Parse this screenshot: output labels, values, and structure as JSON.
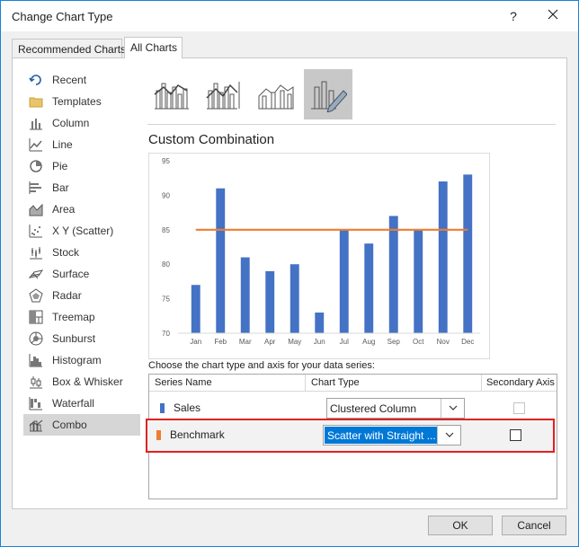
{
  "window": {
    "title": "Change Chart Type",
    "help": "?",
    "close": "✕"
  },
  "tabs": [
    {
      "label": "Recommended Charts"
    },
    {
      "label": "All Charts"
    }
  ],
  "sidebar": {
    "items": [
      {
        "label": "Recent",
        "icon": "recent-icon"
      },
      {
        "label": "Templates",
        "icon": "templates-folder-icon"
      },
      {
        "label": "Column",
        "icon": "column-chart-icon"
      },
      {
        "label": "Line",
        "icon": "line-chart-icon"
      },
      {
        "label": "Pie",
        "icon": "pie-chart-icon"
      },
      {
        "label": "Bar",
        "icon": "bar-chart-icon"
      },
      {
        "label": "Area",
        "icon": "area-chart-icon"
      },
      {
        "label": "X Y (Scatter)",
        "icon": "scatter-chart-icon"
      },
      {
        "label": "Stock",
        "icon": "stock-chart-icon"
      },
      {
        "label": "Surface",
        "icon": "surface-chart-icon"
      },
      {
        "label": "Radar",
        "icon": "radar-chart-icon"
      },
      {
        "label": "Treemap",
        "icon": "treemap-chart-icon"
      },
      {
        "label": "Sunburst",
        "icon": "sunburst-chart-icon"
      },
      {
        "label": "Histogram",
        "icon": "histogram-chart-icon"
      },
      {
        "label": "Box & Whisker",
        "icon": "box-whisker-chart-icon"
      },
      {
        "label": "Waterfall",
        "icon": "waterfall-chart-icon"
      },
      {
        "label": "Combo",
        "icon": "combo-chart-icon"
      }
    ],
    "selected": "Combo"
  },
  "subtypes": {
    "icons": [
      "clustered-column-line-icon",
      "clustered-column-line-secondary-icon",
      "stacked-area-column-icon",
      "custom-combination-icon"
    ],
    "selected": "custom-combination-icon"
  },
  "section_title": "Custom Combination",
  "chart_data": {
    "type": "bar",
    "categories": [
      "Jan",
      "Feb",
      "Mar",
      "Apr",
      "May",
      "Jun",
      "Jul",
      "Aug",
      "Sep",
      "Oct",
      "Nov",
      "Dec"
    ],
    "series": [
      {
        "name": "Sales",
        "type": "bar",
        "values": [
          77,
          91,
          81,
          79,
          80,
          73,
          85,
          83,
          87,
          85,
          92,
          93
        ]
      },
      {
        "name": "Benchmark",
        "type": "line",
        "values": [
          85,
          85,
          85,
          85,
          85,
          85,
          85,
          85,
          85,
          85,
          85,
          85
        ]
      }
    ],
    "yticks": [
      70,
      75,
      80,
      85,
      90,
      95
    ],
    "ylim": [
      70,
      95
    ],
    "bar_color": "#4472c4",
    "line_color": "#ed7d31",
    "title": "",
    "xlabel": "",
    "ylabel": ""
  },
  "choose_label": "Choose the chart type and axis for your data series:",
  "series_table": {
    "headers": {
      "name": "Series Name",
      "type": "Chart Type",
      "axis": "Secondary Axis"
    },
    "rows": [
      {
        "name": "Sales",
        "color": "#4472c4",
        "chart_type": "Clustered Column",
        "secondary": false,
        "secondary_enabled": false
      },
      {
        "name": "Benchmark",
        "color": "#ed7d31",
        "chart_type": "Scatter with Straight ...",
        "secondary": false,
        "secondary_enabled": true
      }
    ]
  },
  "buttons": {
    "ok": "OK",
    "cancel": "Cancel"
  }
}
